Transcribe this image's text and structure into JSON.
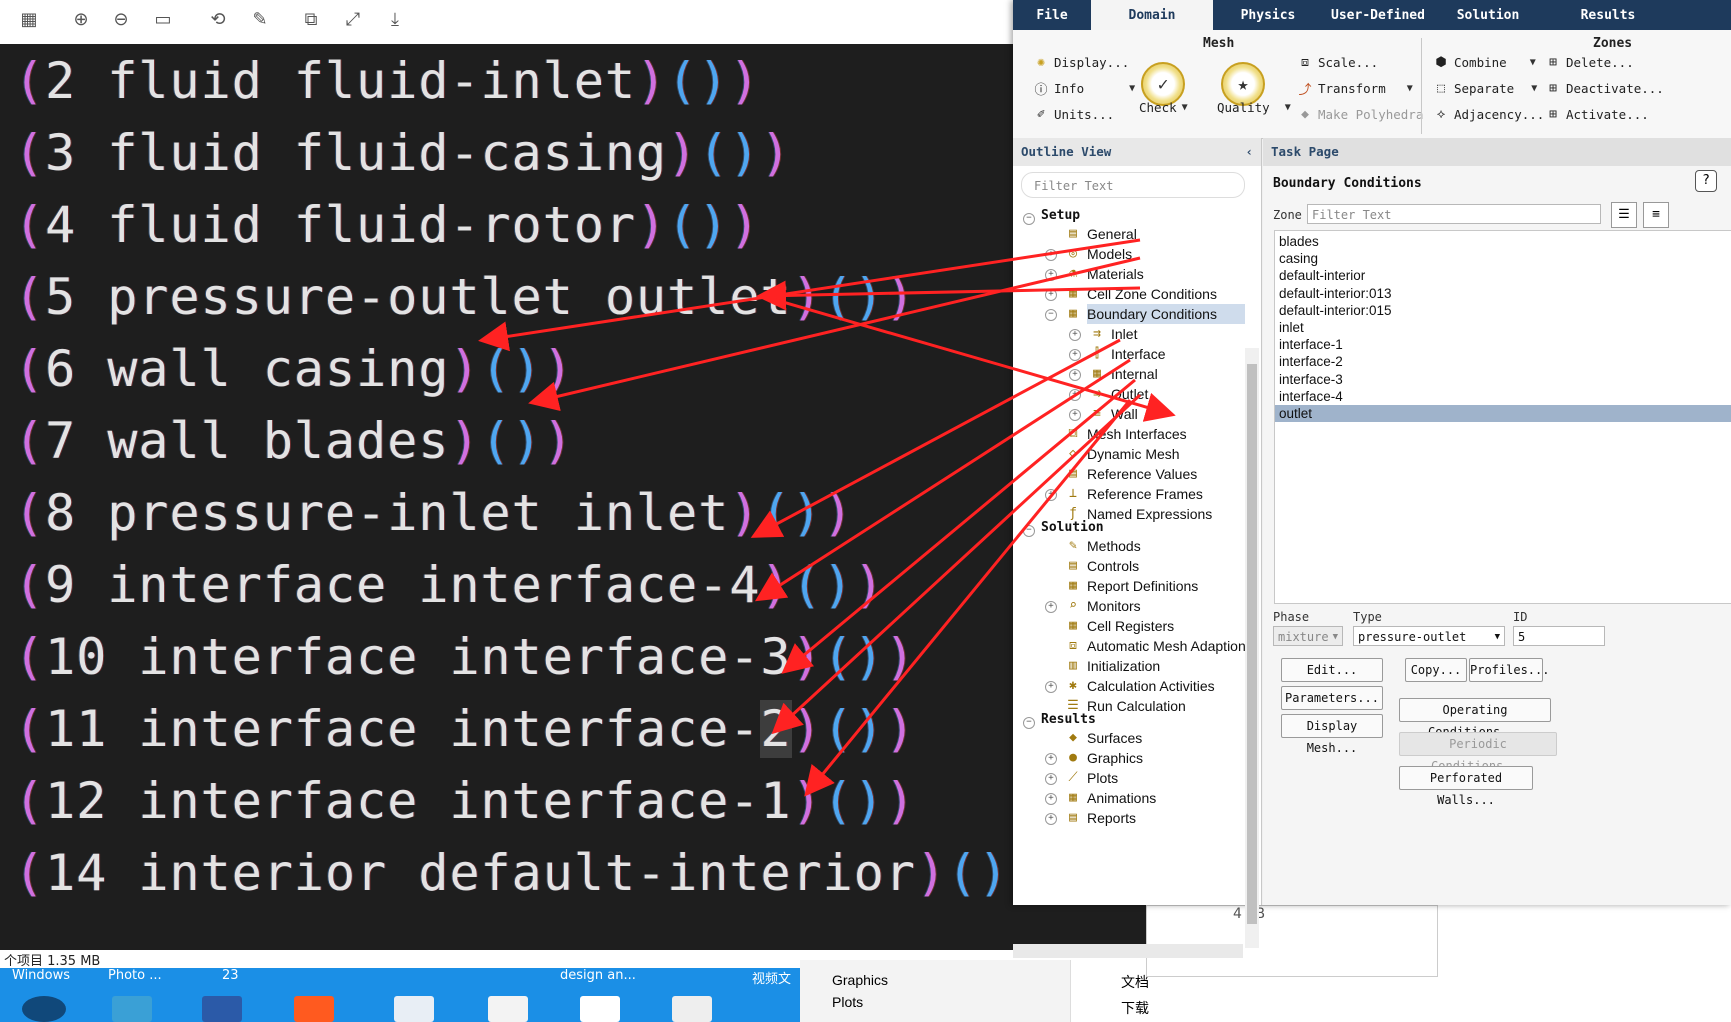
{
  "viewer": {
    "toolbar_icons": [
      "grid-icon",
      "zoom-in-icon",
      "zoom-out-icon",
      "fit-icon",
      "rotate-icon",
      "edit-icon",
      "crop-icon",
      "fullscreen-icon",
      "download-icon"
    ],
    "code_lines": [
      {
        "open": "(",
        "text": "2 fluid fluid-inlet",
        "close": ")())"
      },
      {
        "open": "(",
        "text": "3 fluid fluid-casing",
        "close": ")())"
      },
      {
        "open": "(",
        "text": "4 fluid fluid-rotor",
        "close": ")())"
      },
      {
        "open": "(",
        "text": "5 pressure-outlet outlet",
        "close": ")())"
      },
      {
        "open": "(",
        "text": "6 wall casing",
        "close": ")())"
      },
      {
        "open": "(",
        "text": "7 wall blades",
        "close": ")())"
      },
      {
        "open": "(",
        "text": "8 pressure-inlet inlet",
        "close": ")())"
      },
      {
        "open": "(",
        "text": "9 interface interface-4",
        "close": ")())"
      },
      {
        "open": "(",
        "text": "10 interface interface-3",
        "close": ")())"
      },
      {
        "open": "(",
        "text": "11 interface interface-",
        "highlight": "2",
        "close": ")())"
      },
      {
        "open": "(",
        "text": "12 interface interface-1",
        "close": ")())"
      },
      {
        "open": "(",
        "text": "14 interior default-interior",
        "close": ")())"
      }
    ],
    "status_text": "个项目  1.35 MB"
  },
  "taskbar": {
    "labels": [
      "Windows",
      "Photo ...",
      "23",
      "design an...",
      "视频文"
    ],
    "bg_tree": [
      "Graphics",
      "Plots"
    ],
    "bg_folders": [
      "文档",
      "下载"
    ],
    "bg_size": "4 KB"
  },
  "fluent": {
    "tabs": [
      "File",
      "Domain",
      "Physics",
      "User-Defined",
      "Solution",
      "Results"
    ],
    "active_tab": "Domain",
    "ribbon": {
      "mesh_title": "Mesh",
      "zones_title": "Zones",
      "display": "Display...",
      "info": "Info",
      "units": "Units...",
      "check": "Check",
      "quality": "Quality",
      "scale": "Scale...",
      "transform": "Transform",
      "make_polyhedra": "Make Polyhedra",
      "combine": "Combine",
      "separate": "Separate",
      "adjacency": "Adjacency...",
      "delete": "Delete...",
      "deactivate": "Deactivate...",
      "activate": "Activate..."
    },
    "outline": {
      "title": "Outline View",
      "filter_placeholder": "Filter Text",
      "setup_label": "Setup",
      "setup_items": [
        "General",
        "Models",
        "Materials",
        "Cell Zone Conditions",
        "Boundary Conditions"
      ],
      "bc_children": [
        "Inlet",
        "Interface",
        "Internal",
        "Outlet",
        "Wall"
      ],
      "setup_items2": [
        "Mesh Interfaces",
        "Dynamic Mesh",
        "Reference Values",
        "Reference Frames",
        "Named Expressions"
      ],
      "solution_label": "Solution",
      "solution_items": [
        "Methods",
        "Controls",
        "Report Definitions",
        "Monitors",
        "Cell Registers",
        "Automatic Mesh Adaption",
        "Initialization",
        "Calculation Activities",
        "Run Calculation"
      ],
      "results_label": "Results",
      "results_items": [
        "Surfaces",
        "Graphics",
        "Plots",
        "Animations",
        "Reports"
      ]
    },
    "task": {
      "title": "Task Page",
      "heading": "Boundary Conditions",
      "zone_label": "Zone",
      "zone_filter_placeholder": "Filter Text",
      "zones": [
        "blades",
        "casing",
        "default-interior",
        "default-interior:013",
        "default-interior:015",
        "inlet",
        "interface-1",
        "interface-2",
        "interface-3",
        "interface-4",
        "outlet"
      ],
      "selected_zone": "outlet",
      "phase_label": "Phase",
      "phase_value": "mixture",
      "type_label": "Type",
      "type_value": "pressure-outlet",
      "id_label": "ID",
      "id_value": "5",
      "buttons": {
        "edit": "Edit...",
        "copy": "Copy...",
        "profiles": "Profiles...",
        "parameters": "Parameters...",
        "operating": "Operating Conditions...",
        "display_mesh": "Display Mesh...",
        "periodic": "Periodic Conditions...",
        "perforated": "Perforated Walls..."
      }
    }
  },
  "colors": {
    "code_bg": "#1e1e1e",
    "paren_purple": "#d070e0",
    "paren_yellow": "#f2d14a",
    "paren_blue": "#4fa6f0",
    "ribbon_dark": "#1e3a5c",
    "annotation_arrow": "#ff2222",
    "selection": "#9fb3cb"
  }
}
